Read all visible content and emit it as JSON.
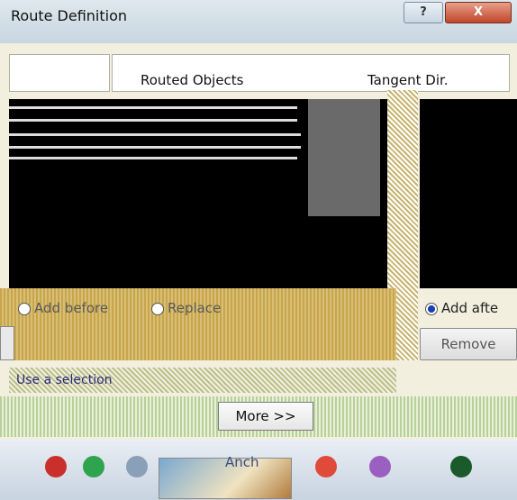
{
  "window": {
    "title": "Route Definition",
    "help_label": "?",
    "close_label": "X"
  },
  "table": {
    "columns": [
      "Routed Objects",
      "Tangent Dir."
    ]
  },
  "options": {
    "add_before": "Add before",
    "replace": "Replace",
    "add_after": "Add afte",
    "selected": "add_after"
  },
  "buttons": {
    "remove": "Remove",
    "more": "More >>"
  },
  "status": {
    "text": "Use a selection"
  },
  "taskbar": {
    "active_label": "Anch"
  },
  "colors": {
    "list_background": "#000000",
    "radio_selected": "#1a3fb0",
    "mid_band": "#c9a54a"
  }
}
